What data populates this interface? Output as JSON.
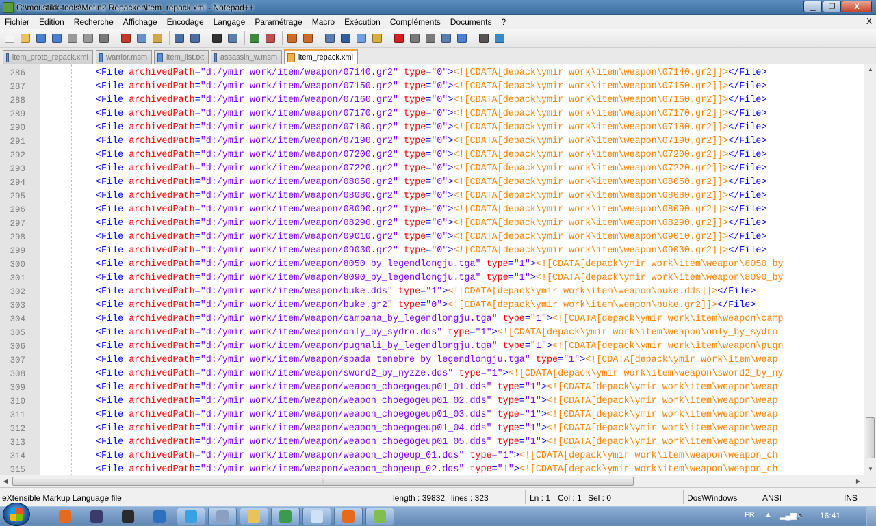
{
  "window": {
    "title": "C:\\moustikk-tools\\Metin2 Repacker\\item_repack.xml - Notepad++",
    "minimize": "▁",
    "maximize": "❐",
    "close": "X"
  },
  "menu": {
    "items": [
      "Fichier",
      "Edition",
      "Recherche",
      "Affichage",
      "Encodage",
      "Langage",
      "Paramétrage",
      "Macro",
      "Exécution",
      "Compléments",
      "Documents",
      "?"
    ],
    "close": "X"
  },
  "toolbar": {
    "buttons": [
      {
        "name": "new-file-icon",
        "color": "#f4f4f4"
      },
      {
        "name": "open-file-icon",
        "color": "#e8c35a"
      },
      {
        "name": "save-icon",
        "color": "#4a7fd0"
      },
      {
        "name": "save-all-icon",
        "color": "#4a7fd0"
      },
      {
        "name": "close-icon",
        "color": "#9a9a9a"
      },
      {
        "name": "close-all-icon",
        "color": "#9a9a9a"
      },
      {
        "name": "print-icon",
        "color": "#7a7a7a"
      },
      {
        "name": "cut-icon",
        "color": "#c0392b"
      },
      {
        "name": "copy-icon",
        "color": "#6b8fc7"
      },
      {
        "name": "paste-icon",
        "color": "#d4a64a"
      },
      {
        "name": "undo-icon",
        "color": "#4b6fa5"
      },
      {
        "name": "redo-icon",
        "color": "#4b6fa5"
      },
      {
        "name": "find-icon",
        "color": "#333333"
      },
      {
        "name": "replace-icon",
        "color": "#5a7fae"
      },
      {
        "name": "zoom-in-icon",
        "color": "#3c8a3c"
      },
      {
        "name": "zoom-out-icon",
        "color": "#c05050"
      },
      {
        "name": "sync-vertical-icon",
        "color": "#d06a2a"
      },
      {
        "name": "sync-horizontal-icon",
        "color": "#d06a2a"
      },
      {
        "name": "word-wrap-icon",
        "color": "#5a7fae"
      },
      {
        "name": "show-all-chars-icon",
        "color": "#2f5f9f"
      },
      {
        "name": "indent-guide-icon",
        "color": "#6f9fe0"
      },
      {
        "name": "user-lang-icon",
        "color": "#d8b040"
      },
      {
        "name": "record-macro-icon",
        "color": "#d02020"
      },
      {
        "name": "stop-macro-icon",
        "color": "#7a7a7a"
      },
      {
        "name": "play-macro-icon",
        "color": "#7a7a7a"
      },
      {
        "name": "play-multiple-icon",
        "color": "#5a7fae"
      },
      {
        "name": "save-macro-icon",
        "color": "#4a7fd0"
      },
      {
        "name": "binoculars-icon",
        "color": "#555555"
      },
      {
        "name": "spellcheck-icon",
        "color": "#3a8ac8"
      }
    ]
  },
  "tabs": [
    {
      "label": "item_proto_repack.xml",
      "active": false
    },
    {
      "label": "warrior.msm",
      "active": false
    },
    {
      "label": "item_list.txt",
      "active": false
    },
    {
      "label": "assassin_w.msm",
      "active": false
    },
    {
      "label": "item_repack.xml",
      "active": true
    }
  ],
  "editor": {
    "lines": [
      {
        "n": "286",
        "path": "\"d:/ymir work/item/weapon/07140.gr2\"",
        "type": "\"0\"",
        "cdata": "<![CDATA[depack\\ymir work\\item\\weapon\\07140.gr2]]>",
        "close": "</File>"
      },
      {
        "n": "287",
        "path": "\"d:/ymir work/item/weapon/07150.gr2\"",
        "type": "\"0\"",
        "cdata": "<![CDATA[depack\\ymir work\\item\\weapon\\07150.gr2]]>",
        "close": "</File>"
      },
      {
        "n": "288",
        "path": "\"d:/ymir work/item/weapon/07160.gr2\"",
        "type": "\"0\"",
        "cdata": "<![CDATA[depack\\ymir work\\item\\weapon\\07160.gr2]]>",
        "close": "</File>"
      },
      {
        "n": "289",
        "path": "\"d:/ymir work/item/weapon/07170.gr2\"",
        "type": "\"0\"",
        "cdata": "<![CDATA[depack\\ymir work\\item\\weapon\\07170.gr2]]>",
        "close": "</File>"
      },
      {
        "n": "290",
        "path": "\"d:/ymir work/item/weapon/07180.gr2\"",
        "type": "\"0\"",
        "cdata": "<![CDATA[depack\\ymir work\\item\\weapon\\07180.gr2]]>",
        "close": "</File>"
      },
      {
        "n": "291",
        "path": "\"d:/ymir work/item/weapon/07190.gr2\"",
        "type": "\"0\"",
        "cdata": "<![CDATA[depack\\ymir work\\item\\weapon\\07190.gr2]]>",
        "close": "</File>"
      },
      {
        "n": "292",
        "path": "\"d:/ymir work/item/weapon/07200.gr2\"",
        "type": "\"0\"",
        "cdata": "<![CDATA[depack\\ymir work\\item\\weapon\\07200.gr2]]>",
        "close": "</File>"
      },
      {
        "n": "293",
        "path": "\"d:/ymir work/item/weapon/07220.gr2\"",
        "type": "\"0\"",
        "cdata": "<![CDATA[depack\\ymir work\\item\\weapon\\07220.gr2]]>",
        "close": "</File>"
      },
      {
        "n": "294",
        "path": "\"d:/ymir work/item/weapon/08050.gr2\"",
        "type": "\"0\"",
        "cdata": "<![CDATA[depack\\ymir work\\item\\weapon\\08050.gr2]]>",
        "close": "</File>"
      },
      {
        "n": "295",
        "path": "\"d:/ymir work/item/weapon/08080.gr2\"",
        "type": "\"0\"",
        "cdata": "<![CDATA[depack\\ymir work\\item\\weapon\\08080.gr2]]>",
        "close": "</File>"
      },
      {
        "n": "296",
        "path": "\"d:/ymir work/item/weapon/08090.gr2\"",
        "type": "\"0\"",
        "cdata": "<![CDATA[depack\\ymir work\\item\\weapon\\08090.gr2]]>",
        "close": "</File>"
      },
      {
        "n": "297",
        "path": "\"d:/ymir work/item/weapon/08290.gr2\"",
        "type": "\"0\"",
        "cdata": "<![CDATA[depack\\ymir work\\item\\weapon\\08290.gr2]]>",
        "close": "</File>"
      },
      {
        "n": "298",
        "path": "\"d:/ymir work/item/weapon/09010.gr2\"",
        "type": "\"0\"",
        "cdata": "<![CDATA[depack\\ymir work\\item\\weapon\\09010.gr2]]>",
        "close": "</File>"
      },
      {
        "n": "299",
        "path": "\"d:/ymir work/item/weapon/09030.gr2\"",
        "type": "\"0\"",
        "cdata": "<![CDATA[depack\\ymir work\\item\\weapon\\09030.gr2]]>",
        "close": "</File>"
      },
      {
        "n": "300",
        "path": "\"d:/ymir work/item/weapon/8050_by_legendlongju.tga\"",
        "type": "\"1\"",
        "cdata": "<![CDATA[depack\\ymir work\\item\\weapon\\8050_by",
        "close": ""
      },
      {
        "n": "301",
        "path": "\"d:/ymir work/item/weapon/8090_by_legendlongju.tga\"",
        "type": "\"1\"",
        "cdata": "<![CDATA[depack\\ymir work\\item\\weapon\\8090_by",
        "close": ""
      },
      {
        "n": "302",
        "path": "\"d:/ymir work/item/weapon/buke.dds\"",
        "type": "\"1\"",
        "cdata": "<![CDATA[depack\\ymir work\\item\\weapon\\buke.dds]]>",
        "close": "</File>"
      },
      {
        "n": "303",
        "path": "\"d:/ymir work/item/weapon/buke.gr2\"",
        "type": "\"0\"",
        "cdata": "<![CDATA[depack\\ymir work\\item\\weapon\\buke.gr2]]>",
        "close": "</File>"
      },
      {
        "n": "304",
        "path": "\"d:/ymir work/item/weapon/campana_by_legendlongju.tga\"",
        "type": "\"1\"",
        "cdata": "<![CDATA[depack\\ymir work\\item\\weapon\\camp",
        "close": ""
      },
      {
        "n": "305",
        "path": "\"d:/ymir work/item/weapon/only_by_sydro.dds\"",
        "type": "\"1\"",
        "cdata": "<![CDATA[depack\\ymir work\\item\\weapon\\only_by_sydro",
        "close": ""
      },
      {
        "n": "306",
        "path": "\"d:/ymir work/item/weapon/pugnali_by_legendlongju.tga\"",
        "type": "\"1\"",
        "cdata": "<![CDATA[depack\\ymir work\\item\\weapon\\pugn",
        "close": ""
      },
      {
        "n": "307",
        "path": "\"d:/ymir work/item/weapon/spada_tenebre_by_legendlongju.tga\"",
        "type": "\"1\"",
        "cdata": "<![CDATA[depack\\ymir work\\item\\weap",
        "close": ""
      },
      {
        "n": "308",
        "path": "\"d:/ymir work/item/weapon/sword2_by_nyzze.dds\"",
        "type": "\"1\"",
        "cdata": "<![CDATA[depack\\ymir work\\item\\weapon\\sword2_by_ny",
        "close": ""
      },
      {
        "n": "309",
        "path": "\"d:/ymir work/item/weapon/weapon_choegogeup01_01.dds\"",
        "type": "\"1\"",
        "cdata": "<![CDATA[depack\\ymir work\\item\\weapon\\weap",
        "close": ""
      },
      {
        "n": "310",
        "path": "\"d:/ymir work/item/weapon/weapon_choegogeup01_02.dds\"",
        "type": "\"1\"",
        "cdata": "<![CDATA[depack\\ymir work\\item\\weapon\\weap",
        "close": ""
      },
      {
        "n": "311",
        "path": "\"d:/ymir work/item/weapon/weapon_choegogeup01_03.dds\"",
        "type": "\"1\"",
        "cdata": "<![CDATA[depack\\ymir work\\item\\weapon\\weap",
        "close": ""
      },
      {
        "n": "312",
        "path": "\"d:/ymir work/item/weapon/weapon_choegogeup01_04.dds\"",
        "type": "\"1\"",
        "cdata": "<![CDATA[depack\\ymir work\\item\\weapon\\weap",
        "close": ""
      },
      {
        "n": "313",
        "path": "\"d:/ymir work/item/weapon/weapon_choegogeup01_05.dds\"",
        "type": "\"1\"",
        "cdata": "<![CDATA[depack\\ymir work\\item\\weapon\\weap",
        "close": ""
      },
      {
        "n": "314",
        "path": "\"d:/ymir work/item/weapon/weapon_chogeup_01.dds\"",
        "type": "\"1\"",
        "cdata": "<![CDATA[depack\\ymir work\\item\\weapon\\weapon_ch",
        "close": ""
      },
      {
        "n": "315",
        "path": "\"d:/ymir work/item/weapon/weapon_chogeup_02.dds\"",
        "type": "\"1\"",
        "cdata": "<![CDATA[depack\\ymir work\\item\\weapon\\weapon_ch",
        "close": ""
      }
    ],
    "syntax": {
      "tag": "#0000ff",
      "attr": "#ff0000",
      "value": "#8000ff",
      "cdata": "#ff8000"
    }
  },
  "status": {
    "filetype": "eXtensible Markup Language file",
    "length": "length : 39832",
    "lines": "lines : 323",
    "ln": "Ln : 1",
    "col": "Col : 1",
    "sel": "Sel : 0",
    "eol": "Dos\\Windows",
    "encoding": "ANSI",
    "mode": "INS"
  },
  "taskbar": {
    "apps": [
      {
        "name": "firefox-icon",
        "color": "#e66a1c",
        "open": false
      },
      {
        "name": "after-effects-icon",
        "color": "#3b3b6b",
        "open": false
      },
      {
        "name": "game-icon",
        "color": "#2b2b2b",
        "open": false
      },
      {
        "name": "media-icon",
        "color": "#2f6fc0",
        "open": false
      },
      {
        "name": "network-icon",
        "color": "#3aa0e0",
        "open": true
      },
      {
        "name": "installer-icon",
        "color": "#8aa0c0",
        "open": true
      },
      {
        "name": "explorer-icon",
        "color": "#e8c35a",
        "open": true
      },
      {
        "name": "paint-icon",
        "color": "#3c9a4c",
        "open": true
      },
      {
        "name": "notepad-icon",
        "color": "#cfe2f5",
        "open": true
      },
      {
        "name": "firefox-window-icon",
        "color": "#e66a1c",
        "open": true
      },
      {
        "name": "notepadpp-icon",
        "color": "#7fbf4f",
        "open": true
      }
    ],
    "language": "FR",
    "clock": "16:41"
  }
}
